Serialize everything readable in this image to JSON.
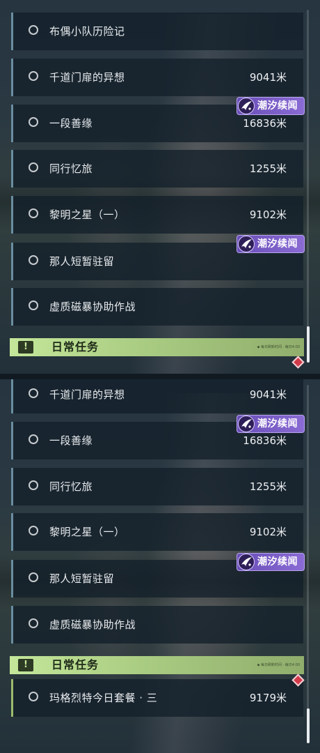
{
  "top_list": {
    "rows": [
      {
        "title": "布偶小队历险记",
        "distance": ""
      },
      {
        "title": "千道门扉的异想",
        "distance": "9041米"
      },
      {
        "title": "一段善缘",
        "distance": "16836米"
      },
      {
        "title": "同行忆旅",
        "distance": "1255米"
      },
      {
        "title": "黎明之星（一）",
        "distance": "9102米"
      },
      {
        "title": "那人短暂驻留",
        "distance": ""
      },
      {
        "title": "虚质磁暴协助作战",
        "distance": ""
      }
    ],
    "badges": [
      "潮汐续闻",
      "潮汐续闻"
    ],
    "section_header": {
      "icon": "!",
      "title": "日常任务",
      "subtext": "◆ 每日刷新时间 · 每日4:00"
    },
    "scroll_position": 0.92
  },
  "bottom_list": {
    "rows": [
      {
        "title": "千道门扉的异想",
        "distance": "9041米"
      },
      {
        "title": "一段善缘",
        "distance": "16836米"
      },
      {
        "title": "同行忆旅",
        "distance": "1255米"
      },
      {
        "title": "黎明之星（一）",
        "distance": "9102米"
      },
      {
        "title": "那人短暂驻留",
        "distance": ""
      },
      {
        "title": "虚质磁暴协助作战",
        "distance": ""
      }
    ],
    "badges": [
      "潮汐续闻",
      "潮汐续闻"
    ],
    "section_header": {
      "icon": "!",
      "title": "日常任务",
      "subtext": "◆ 每日刷新时间 · 每日4:00"
    },
    "daily_rows": [
      {
        "title": "玛格烈特今日套餐 · 三",
        "distance": "9179米"
      }
    ],
    "scroll_position": 1.0
  },
  "colors": {
    "quest_accent": "#6a8ea0",
    "daily_accent": "#9dbb6e",
    "badge_purple": "#7a5cc8",
    "header_green": "#b6d98c",
    "gem_red": "#d23a4a"
  },
  "icons": {
    "row_marker": "circle-outline-icon",
    "badge": "tidal-wing-icon",
    "section": "exclamation-icon",
    "alert": "red-diamond-icon"
  }
}
